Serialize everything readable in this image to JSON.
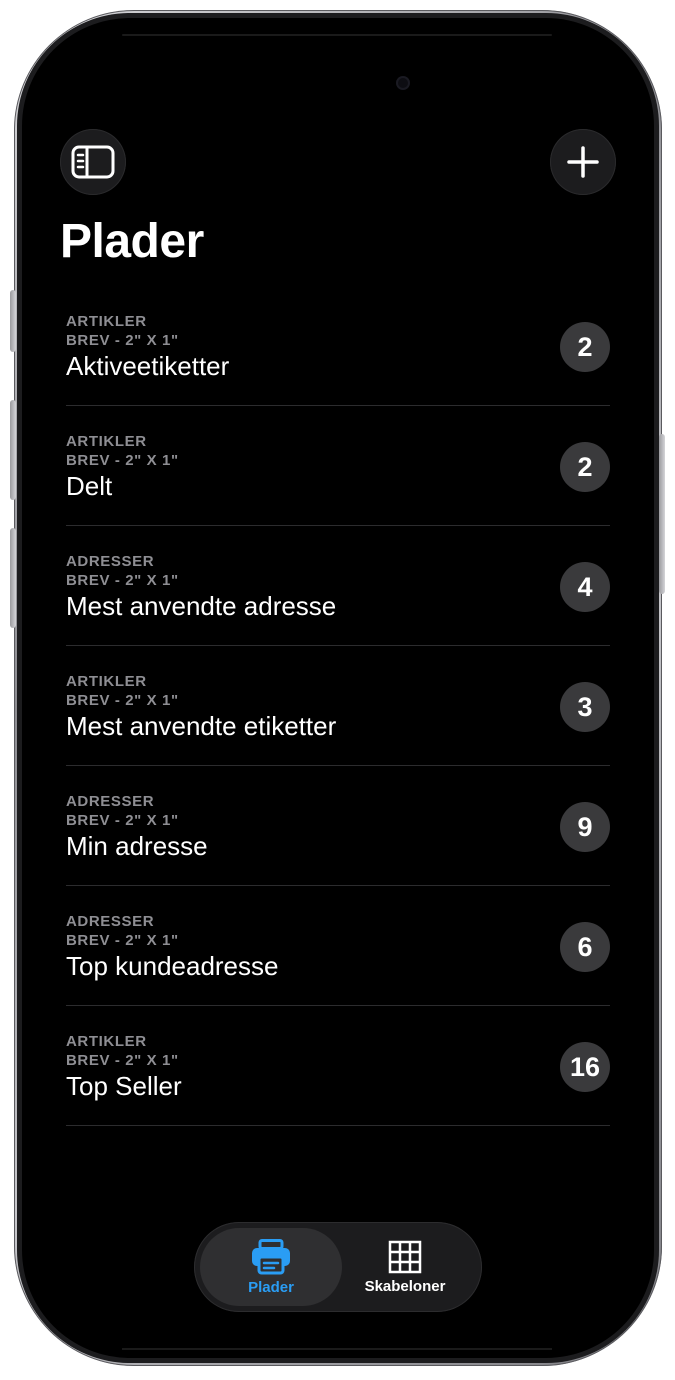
{
  "header": {
    "title": "Plader"
  },
  "sheets": [
    {
      "category": "ARTIKLER",
      "format": "BREV - 2\" X 1\"",
      "name": "Aktiveetiketter",
      "count": "2"
    },
    {
      "category": "ARTIKLER",
      "format": "BREV - 2\" X 1\"",
      "name": "Delt",
      "count": "2"
    },
    {
      "category": "ADRESSER",
      "format": "BREV - 2\" X 1\"",
      "name": "Mest anvendte adresse",
      "count": "4"
    },
    {
      "category": "ARTIKLER",
      "format": "BREV - 2\" X 1\"",
      "name": "Mest anvendte etiketter",
      "count": "3"
    },
    {
      "category": "ADRESSER",
      "format": "BREV - 2\" X 1\"",
      "name": "Min adresse",
      "count": "9"
    },
    {
      "category": "ADRESSER",
      "format": "BREV - 2\" X 1\"",
      "name": "Top kundeadresse",
      "count": "6"
    },
    {
      "category": "ARTIKLER",
      "format": "BREV - 2\" X 1\"",
      "name": "Top Seller",
      "count": "16"
    }
  ],
  "tabbar": {
    "tabs": [
      {
        "label": "Plader",
        "icon": "printer-icon",
        "active": true
      },
      {
        "label": "Skabeloner",
        "icon": "grid-icon",
        "active": false
      }
    ]
  },
  "colors": {
    "background": "#000000",
    "accent": "#2a9df4",
    "secondary_text": "#8e8e93",
    "badge": "#3a3a3c"
  }
}
